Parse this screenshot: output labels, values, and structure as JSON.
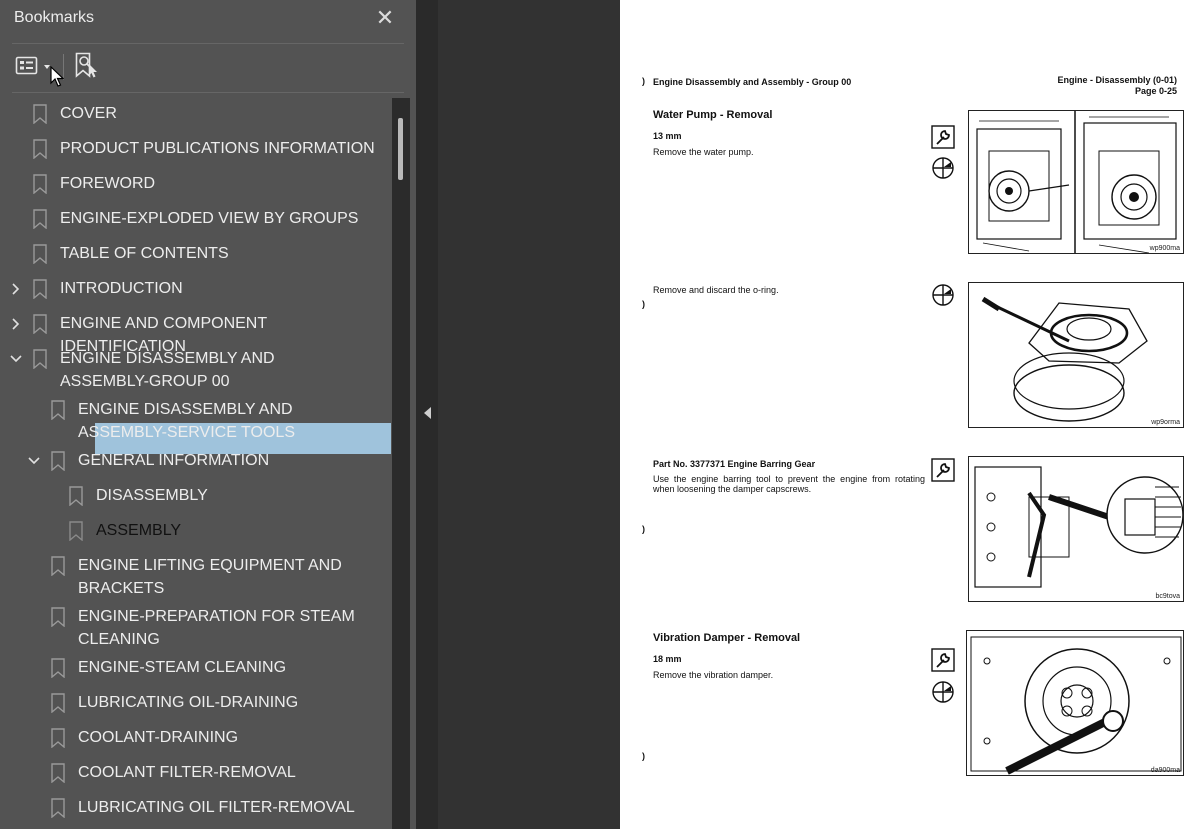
{
  "panel": {
    "title": "Bookmarks",
    "close_glyph": "✕",
    "toolbar": {
      "options_icon": "bookmark-options-icon",
      "find_icon": "find-current-bookmark-icon"
    }
  },
  "bookmarks": [
    {
      "label": "COVER",
      "expandable": false,
      "expanded": false
    },
    {
      "label": "PRODUCT PUBLICATIONS INFORMATION",
      "expandable": false,
      "expanded": false
    },
    {
      "label": "FOREWORD",
      "expandable": false,
      "expanded": false
    },
    {
      "label": "ENGINE-EXPLODED VIEW BY GROUPS",
      "expandable": false,
      "expanded": false
    },
    {
      "label": "TABLE OF CONTENTS",
      "expandable": false,
      "expanded": false
    },
    {
      "label": "INTRODUCTION",
      "expandable": true,
      "expanded": false
    },
    {
      "label": "ENGINE AND COMPONENT IDENTIFICATION",
      "expandable": true,
      "expanded": false
    },
    {
      "label": "ENGINE DISASSEMBLY AND\nASSEMBLY-GROUP 00",
      "expandable": true,
      "expanded": true
    },
    {
      "label": "ENGINE DISASSEMBLY AND\nASSEMBLY-SERVICE TOOLS",
      "expandable": false,
      "expanded": false
    },
    {
      "label": "GENERAL INFORMATION",
      "expandable": true,
      "expanded": true
    },
    {
      "label": "DISASSEMBLY",
      "expandable": false,
      "expanded": false
    },
    {
      "label": "ASSEMBLY",
      "expandable": false,
      "expanded": false,
      "selected": true
    },
    {
      "label": "ENGINE LIFTING EQUIPMENT AND\nBRACKETS",
      "expandable": false,
      "expanded": false
    },
    {
      "label": "ENGINE-PREPARATION FOR STEAM\nCLEANING",
      "expandable": false,
      "expanded": false
    },
    {
      "label": "ENGINE-STEAM CLEANING",
      "expandable": false,
      "expanded": false
    },
    {
      "label": "LUBRICATING OIL-DRAINING",
      "expandable": false,
      "expanded": false
    },
    {
      "label": "COOLANT-DRAINING",
      "expandable": false,
      "expanded": false
    },
    {
      "label": "COOLANT FILTER-REMOVAL",
      "expandable": false,
      "expanded": false
    },
    {
      "label": "LUBRICATING OIL FILTER-REMOVAL",
      "expandable": false,
      "expanded": false
    }
  ],
  "document": {
    "header_left": "Engine Disassembly and Assembly - Group 00",
    "header_right_line1": "Engine - Disassembly (0-01)",
    "header_right_line2": "Page 0-25",
    "sections": [
      {
        "title": "Water Pump - Removal",
        "size": "13 mm",
        "text": "Remove the water pump.",
        "fig_code": "wp900ma"
      },
      {
        "title": "",
        "size": "",
        "text": "Remove and discard the o-ring.",
        "fig_code": "wp9orma"
      },
      {
        "title": "Part No. 3377371 Engine Barring Gear",
        "size": "",
        "text": "Use the engine barring tool to prevent the engine from rotating when loosening the damper capscrews.",
        "fig_code": "bc9tova"
      },
      {
        "title": "Vibration Damper - Removal",
        "size": "18 mm",
        "text": "Remove the vibration damper.",
        "fig_code": "da900ma"
      }
    ]
  }
}
